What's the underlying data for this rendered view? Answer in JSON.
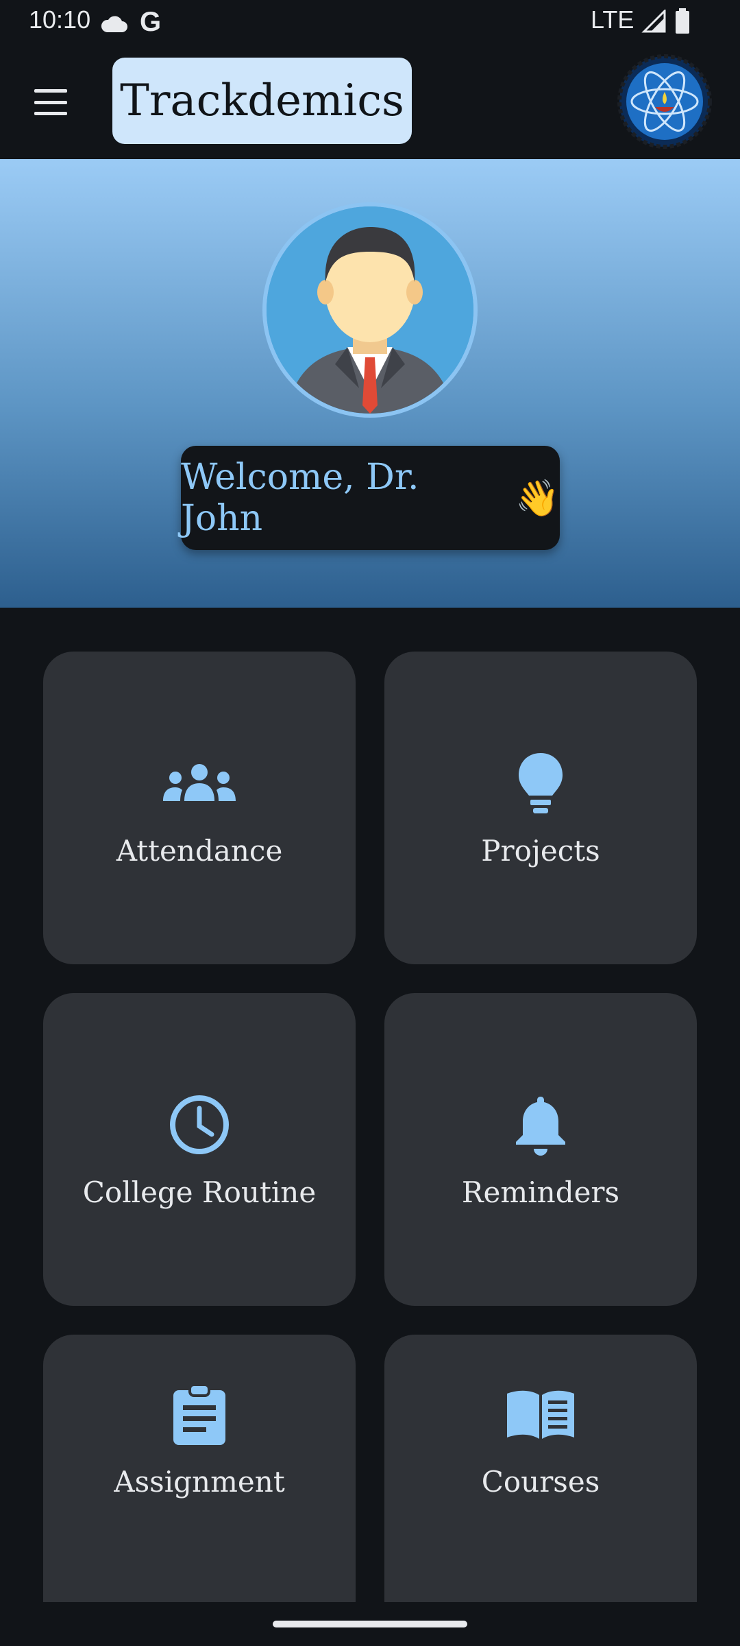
{
  "status_bar": {
    "time": "10:10",
    "network": "LTE",
    "google_glyph": "G"
  },
  "app_bar": {
    "title": "Trackdemics"
  },
  "hero": {
    "welcome_text": "Welcome, Dr. John",
    "wave_emoji": "👋"
  },
  "menu": [
    {
      "label": "Attendance",
      "icon": "people-group-icon"
    },
    {
      "label": "Projects",
      "icon": "lightbulb-icon"
    },
    {
      "label": "College Routine",
      "icon": "clock-icon"
    },
    {
      "label": "Reminders",
      "icon": "bell-icon"
    },
    {
      "label": "Assignment",
      "icon": "clipboard-icon"
    },
    {
      "label": "Courses",
      "icon": "open-book-icon"
    }
  ],
  "colors": {
    "background": "#111418",
    "card": "#2f3237",
    "accent": "#8ec8f7",
    "title_box": "#cfe6fb"
  }
}
